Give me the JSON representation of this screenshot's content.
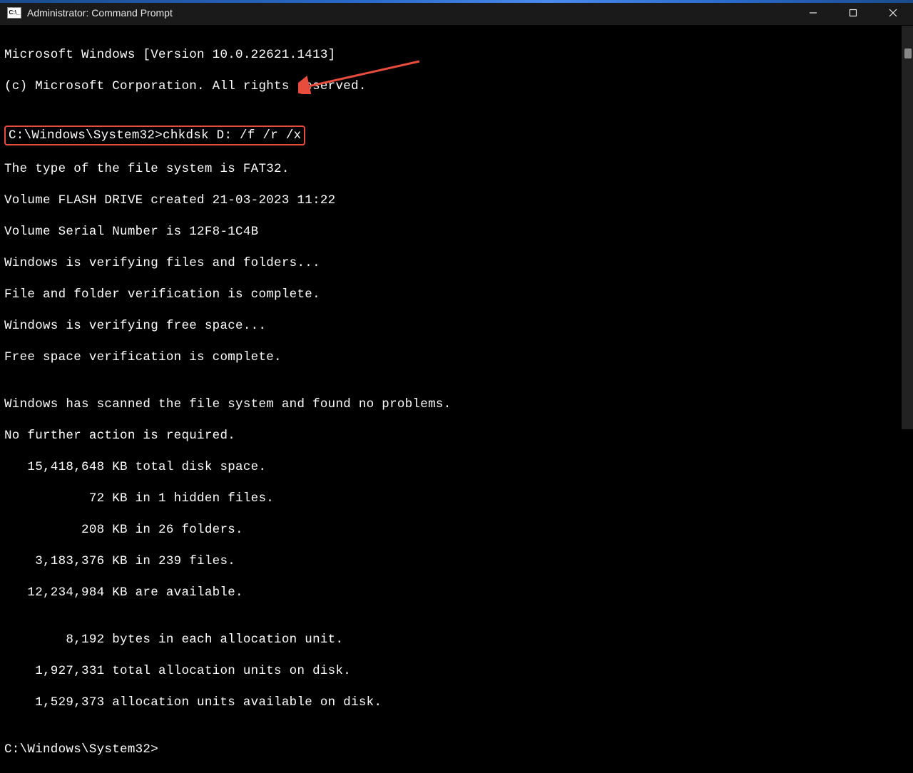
{
  "titlebar": {
    "icon_label": "C:\\_",
    "title": "Administrator: Command Prompt"
  },
  "terminal": {
    "line1": "Microsoft Windows [Version 10.0.22621.1413]",
    "line2": "(c) Microsoft Corporation. All rights reserved.",
    "blank1": "",
    "prompt1": "C:\\Windows\\System32>chkdsk D: /f /r /x",
    "line3": "The type of the file system is FAT32.",
    "line4": "Volume FLASH DRIVE created 21-03-2023 11:22",
    "line5": "Volume Serial Number is 12F8-1C4B",
    "line6": "Windows is verifying files and folders...",
    "line7": "File and folder verification is complete.",
    "line8": "Windows is verifying free space...",
    "line9": "Free space verification is complete.",
    "blank2": "",
    "line10": "Windows has scanned the file system and found no problems.",
    "line11": "No further action is required.",
    "line12": "   15,418,648 KB total disk space.",
    "line13": "           72 KB in 1 hidden files.",
    "line14": "          208 KB in 26 folders.",
    "line15": "    3,183,376 KB in 239 files.",
    "line16": "   12,234,984 KB are available.",
    "blank3": "",
    "line17": "        8,192 bytes in each allocation unit.",
    "line18": "    1,927,331 total allocation units on disk.",
    "line19": "    1,529,373 allocation units available on disk.",
    "blank4": "",
    "prompt2": "C:\\Windows\\System32>"
  },
  "annotation": {
    "highlight_color": "#e74c3c",
    "arrow_color": "#e74c3c"
  }
}
